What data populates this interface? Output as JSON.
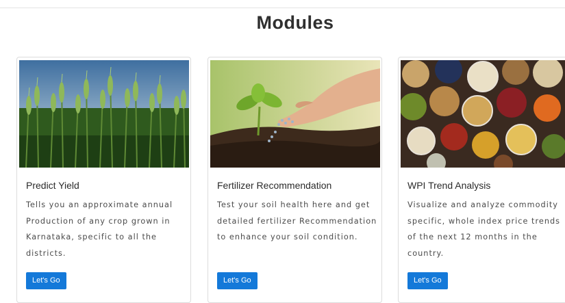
{
  "page": {
    "heading": "Modules"
  },
  "modules": [
    {
      "title": "Predict Yield",
      "description": "Tells you an approximate annual Production of any crop grown in Karnataka, specific to all the districts.",
      "button_label": "Let's Go",
      "image": "wheat-field-image"
    },
    {
      "title": "Fertilizer Recommendation",
      "description": "Test your soil health here and get detailed fertilizer Recommendation to enhance your soil condition.",
      "button_label": "Let's Go",
      "image": "hand-fertilizing-seedling-image"
    },
    {
      "title": "WPI Trend Analysis",
      "description": "Visualize and analyze commodity specific, whole index price trends of the next 12 months in the country.",
      "button_label": "Let's Go",
      "image": "grains-and-spices-image"
    }
  ],
  "colors": {
    "button": "#1479d9",
    "heading": "#2f2f2f"
  }
}
